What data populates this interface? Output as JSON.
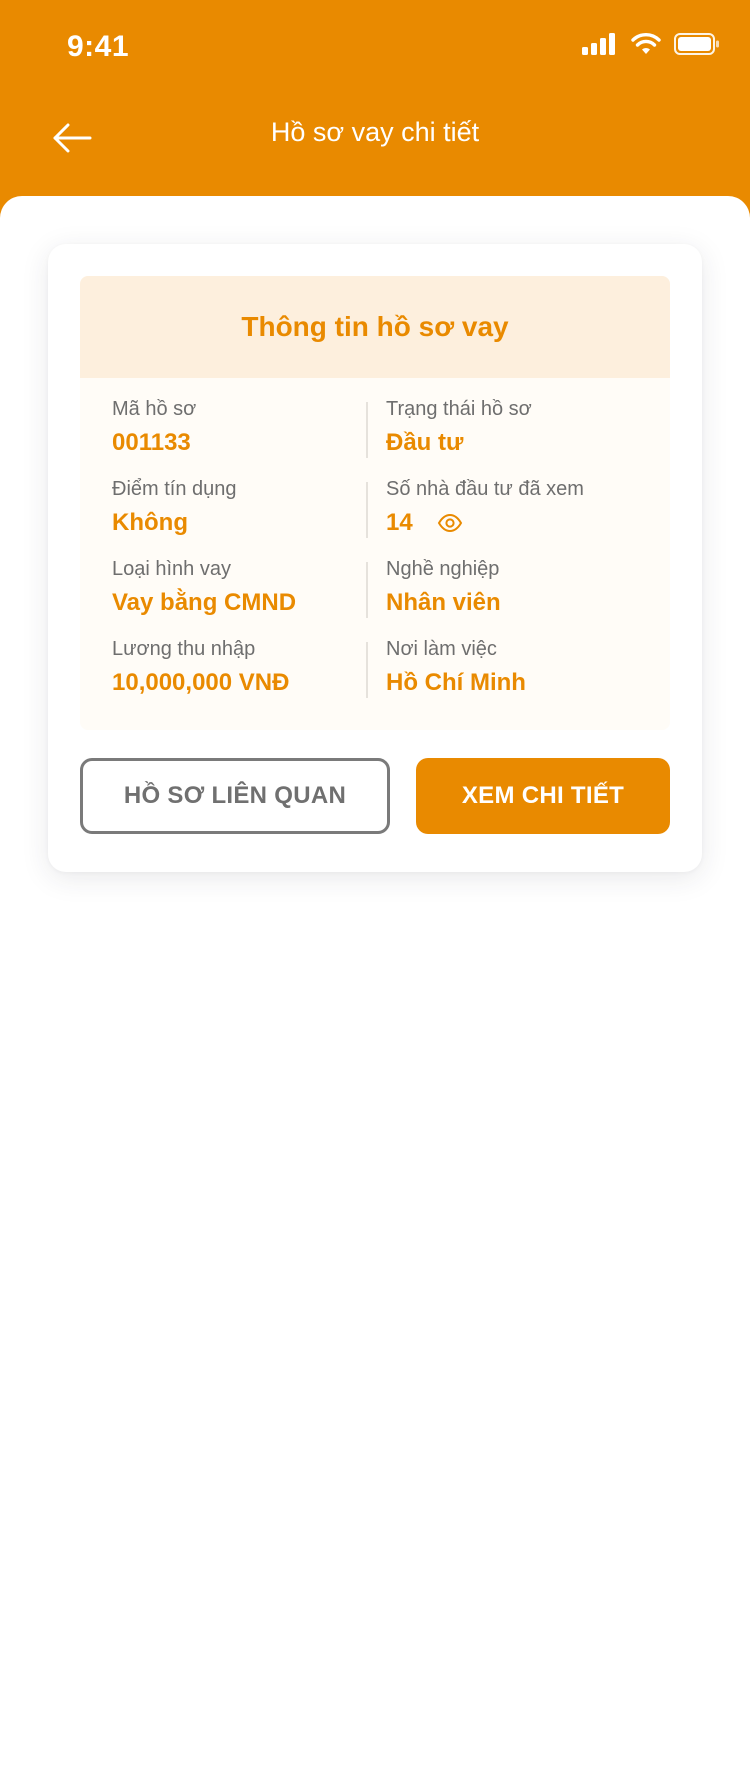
{
  "status_bar": {
    "time": "9:41",
    "icons": [
      "signal-icon",
      "wifi-icon",
      "battery-icon"
    ]
  },
  "header": {
    "title": "Hồ sơ vay chi tiết",
    "back_icon": "arrow-left-icon"
  },
  "loan_card": {
    "section_title": "Thông tin hồ sơ vay",
    "fields": [
      {
        "label": "Mã hồ sơ",
        "value": "001133"
      },
      {
        "label": "Trạng thái hồ sơ",
        "value": "Đầu tư"
      },
      {
        "label": "Điểm tín dụng",
        "value": "Không"
      },
      {
        "label": "Số nhà đầu tư đã xem",
        "value": "14"
      },
      {
        "label": "Loại hình vay",
        "value": "Vay bằng CMND"
      },
      {
        "label": "Nghề nghiệp",
        "value": "Nhân viên"
      },
      {
        "label": "Lương thu nhập",
        "value": "10,000,000 VNĐ"
      },
      {
        "label": "Nơi làm việc",
        "value": "Hồ Chí Minh"
      }
    ],
    "actions": {
      "related_label": "HỒ SƠ LIÊN QUAN",
      "detail_label": "XEM CHI TIẾT"
    }
  },
  "colors": {
    "brand": "#e98a00",
    "panel_header": "#fdefdd",
    "label_text": "#6e6e6e"
  }
}
